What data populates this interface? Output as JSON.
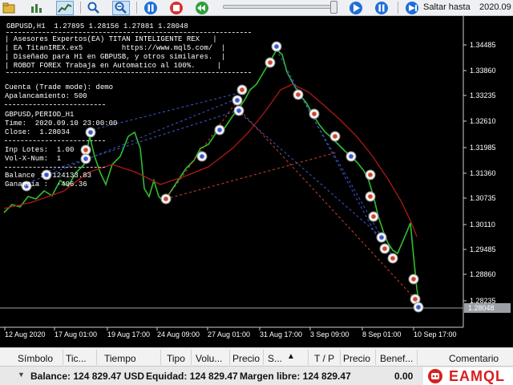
{
  "toolbar": {
    "jump_label": "Saltar hasta",
    "jump_date": "2020.09",
    "icons": [
      "folder-icon",
      "bar-chart-icon",
      "line-chart-icon",
      "zoom-in-icon",
      "zoom-out-icon",
      "pause-icon",
      "stop-icon",
      "step-icon",
      "play-icon",
      "jump-to-date-icon"
    ]
  },
  "chart": {
    "symbol_line": "GBPUSD,H1  1.27895 1.28156 1.27881 1.28048",
    "ea_box": [
      "| Asesores Expertos(EA) TITAN INTELIGENTE REX   |",
      "| EA TitanIREX.ex5         https://www.mql5.com/  |",
      "| Diseñado para H1 en GBPUSB, y otros similares.  |",
      "| ROBOT FOREX Trabaja en Automatico al 100%.     |"
    ],
    "trade_mode": "Cuenta (Trade mode): demo",
    "leverage": "Apalancamiento: 500",
    "period": "GBPUSD,PERIOD_H1",
    "time": "Time:  2020.09.10 23:00:00",
    "close": "Close:  1.28034",
    "inp_lotes": "Inp Lotes:  1.00",
    "vol_x_num": "Vol-X-Num:  1",
    "balance": "Balance :  124133.83",
    "ganancia": "Ganancia :  -496.36",
    "current_price": "1.28048",
    "price_labels": [
      "1.34485",
      "1.33860",
      "1.33235",
      "1.32610",
      "1.31985",
      "1.31360",
      "1.30735",
      "1.30110",
      "1.29485",
      "1.28860",
      "1.28235"
    ],
    "date_labels": [
      "12 Aug 2020",
      "17 Aug 01:00",
      "19 Aug 17:00",
      "24 Aug 09:00",
      "27 Aug 01:00",
      "31 Aug 17:00",
      "3 Sep 09:00",
      "8 Sep 01:00",
      "10 Sep 17:00"
    ],
    "colors": {
      "price_line": "#2fbf2f",
      "ma_line": "#b01818",
      "buy_trades": "#3a5bd0",
      "sell_trades": "#d0452a",
      "background": "#000000"
    }
  },
  "terminal": {
    "columns": [
      "Símbolo",
      "Tic...",
      "Tiempo",
      "Tipo",
      "Volu...",
      "Precio",
      "S...",
      "T / P",
      "Precio",
      "Benef...",
      "Comentario"
    ],
    "balance_line": "Balance: 124 829.47 USD",
    "equity_line": "Equidad: 124 829.47",
    "free_margin_line": "Margen libre: 124 829.47",
    "profit_total": "0.00"
  },
  "logo": {
    "text": "EAMQL"
  }
}
